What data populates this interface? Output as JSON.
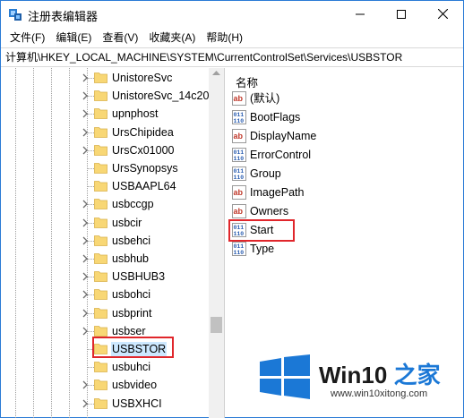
{
  "window": {
    "title": "注册表编辑器"
  },
  "menubar": {
    "items": [
      {
        "label": "文件(F)"
      },
      {
        "label": "编辑(E)"
      },
      {
        "label": "查看(V)"
      },
      {
        "label": "收藏夹(A)"
      },
      {
        "label": "帮助(H)"
      }
    ]
  },
  "address": {
    "path": "计算机\\HKEY_LOCAL_MACHINE\\SYSTEM\\CurrentControlSet\\Services\\USBSTOR"
  },
  "tree": {
    "items": [
      {
        "label": "UnistoreSvc",
        "expandable": true,
        "selected": false
      },
      {
        "label": "UnistoreSvc_14c20",
        "expandable": true,
        "selected": false
      },
      {
        "label": "upnphost",
        "expandable": true,
        "selected": false
      },
      {
        "label": "UrsChipidea",
        "expandable": true,
        "selected": false
      },
      {
        "label": "UrsCx01000",
        "expandable": true,
        "selected": false
      },
      {
        "label": "UrsSynopsys",
        "expandable": false,
        "selected": false
      },
      {
        "label": "USBAAPL64",
        "expandable": false,
        "selected": false
      },
      {
        "label": "usbccgp",
        "expandable": true,
        "selected": false
      },
      {
        "label": "usbcir",
        "expandable": true,
        "selected": false
      },
      {
        "label": "usbehci",
        "expandable": true,
        "selected": false
      },
      {
        "label": "usbhub",
        "expandable": true,
        "selected": false
      },
      {
        "label": "USBHUB3",
        "expandable": true,
        "selected": false
      },
      {
        "label": "usbohci",
        "expandable": true,
        "selected": false
      },
      {
        "label": "usbprint",
        "expandable": true,
        "selected": false
      },
      {
        "label": "usbser",
        "expandable": true,
        "selected": false
      },
      {
        "label": "USBSTOR",
        "expandable": false,
        "selected": true
      },
      {
        "label": "usbuhci",
        "expandable": false,
        "selected": false
      },
      {
        "label": "usbvideo",
        "expandable": true,
        "selected": false
      },
      {
        "label": "USBXHCI",
        "expandable": true,
        "selected": false
      }
    ]
  },
  "values": {
    "column_name": "名称",
    "items": [
      {
        "name": "(默认)",
        "type": "string"
      },
      {
        "name": "BootFlags",
        "type": "binary"
      },
      {
        "name": "DisplayName",
        "type": "string"
      },
      {
        "name": "ErrorControl",
        "type": "binary"
      },
      {
        "name": "Group",
        "type": "binary"
      },
      {
        "name": "ImagePath",
        "type": "string"
      },
      {
        "name": "Owners",
        "type": "string"
      },
      {
        "name": "Start",
        "type": "binary"
      },
      {
        "name": "Type",
        "type": "binary"
      }
    ]
  },
  "watermark": {
    "brand_prefix": "Win10",
    "brand_suffix": " 之家",
    "url": "www.win10xitong.com"
  },
  "colors": {
    "highlight_box": "#e0262b",
    "selection": "#cce8ff",
    "folder": "#f8d775",
    "string_icon": "#c0392b",
    "binary_icon": "#2a5db0",
    "win_blue": "#1b78d6"
  }
}
